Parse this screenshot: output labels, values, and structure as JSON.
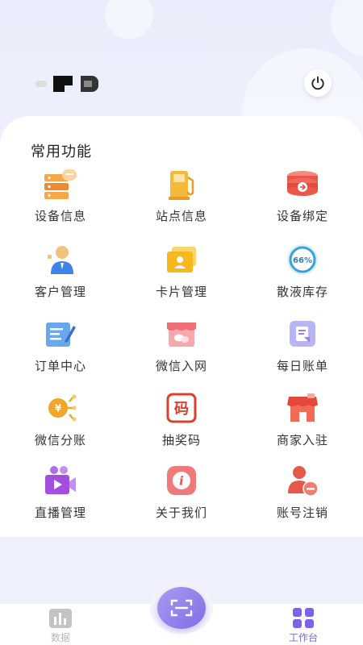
{
  "header": {
    "user_name_obscured": "",
    "power_icon": "power-icon"
  },
  "section": {
    "title": "常用功能"
  },
  "functions": [
    {
      "label": "设备信息",
      "icon": "device-info-icon"
    },
    {
      "label": "站点信息",
      "icon": "gas-station-icon"
    },
    {
      "label": "设备绑定",
      "icon": "device-bind-icon"
    },
    {
      "label": "客户管理",
      "icon": "customer-icon"
    },
    {
      "label": "卡片管理",
      "icon": "card-icon"
    },
    {
      "label": "散液库存",
      "icon": "inventory-gauge-icon"
    },
    {
      "label": "订单中心",
      "icon": "order-edit-icon"
    },
    {
      "label": "微信入网",
      "icon": "wechat-shop-icon"
    },
    {
      "label": "每日账单",
      "icon": "daily-bill-icon"
    },
    {
      "label": "微信分账",
      "icon": "split-payment-icon"
    },
    {
      "label": "抽奖码",
      "icon": "lottery-code-icon"
    },
    {
      "label": "商家入驻",
      "icon": "merchant-store-icon"
    },
    {
      "label": "直播管理",
      "icon": "live-camera-icon"
    },
    {
      "label": "关于我们",
      "icon": "info-icon"
    },
    {
      "label": "账号注销",
      "icon": "account-remove-icon"
    }
  ],
  "gauge_text": "66%",
  "lottery_glyph": "码",
  "currency_glyph": "¥",
  "info_glyph": "i",
  "tabs": [
    {
      "label": "数据",
      "icon": "bar-chart-icon",
      "active": false
    },
    {
      "label": "工作台",
      "icon": "workbench-grid-icon",
      "active": true
    }
  ],
  "colors": {
    "accent": "#7b63e6",
    "inactive_tab": "#b7b7b7"
  }
}
